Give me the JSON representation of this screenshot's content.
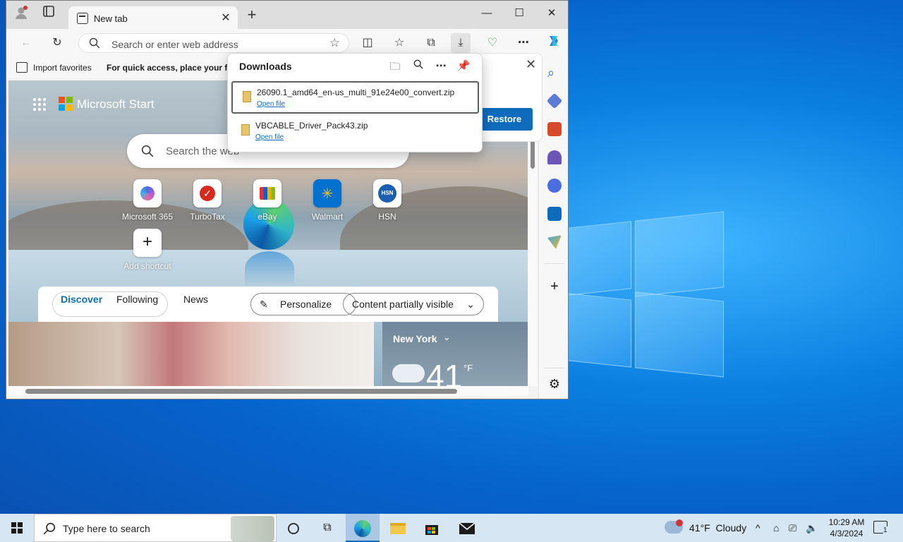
{
  "browser": {
    "tab_title": "New tab",
    "address_placeholder": "Search or enter web address",
    "favorites": {
      "import_label": "Import favorites",
      "hint_text": "For quick access, place your fa"
    }
  },
  "downloads": {
    "title": "Downloads",
    "items": [
      {
        "filename": "26090.1_amd64_en-us_multi_91e24e00_convert.zip",
        "action": "Open file"
      },
      {
        "filename": "VBCABLE_Driver_Pack43.zip",
        "action": "Open file"
      }
    ],
    "restore_label": "Restore"
  },
  "new_tab_page": {
    "brand": "Microsoft Start",
    "search_placeholder": "Search the web",
    "shortcuts": [
      {
        "label": "Microsoft 365"
      },
      {
        "label": "TurboTax"
      },
      {
        "label": "eBay"
      },
      {
        "label": "Walmart"
      },
      {
        "label": "HSN",
        "icon_text": "HSN"
      }
    ],
    "add_shortcut": "Add shortcut",
    "feed_tabs": [
      "Discover",
      "Following",
      "News"
    ],
    "personalize": "Personalize",
    "content_visibility": "Content partially visible",
    "weather": {
      "city": "New York",
      "temp": "41",
      "unit": "°F"
    }
  },
  "taskbar": {
    "search_text": "Type here to search",
    "weather_text": "41°F  Cloudy",
    "time": "10:29 AM",
    "date": "4/3/2024",
    "notification_count": "1"
  },
  "colors": {
    "accent": "#0f6cbd",
    "desktop": "#0a7fe0"
  }
}
